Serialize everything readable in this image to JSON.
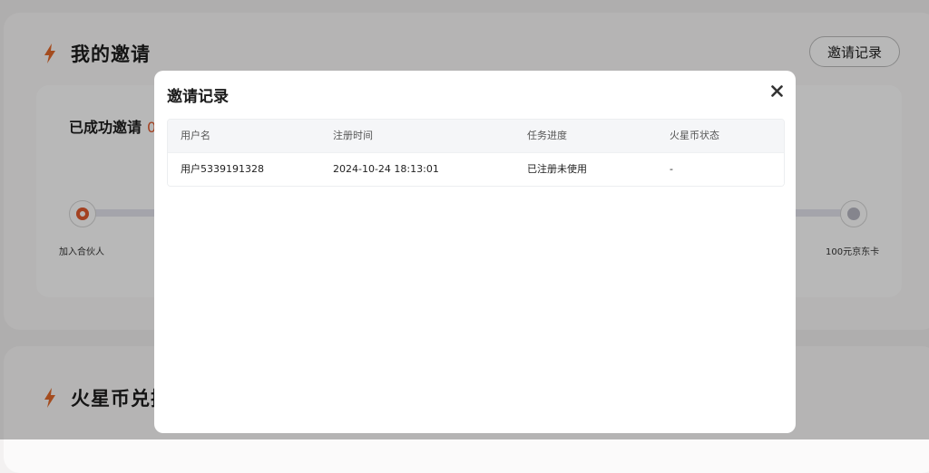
{
  "background": {
    "invite_section": {
      "title": "我的邀请",
      "record_button": "邀请记录",
      "success_label": "已成功邀请",
      "success_count": "0",
      "progress": {
        "start_label": "加入合伙人",
        "end_label": "100元京东卡"
      }
    },
    "exchange_section": {
      "title": "火星币兑换"
    }
  },
  "modal": {
    "title": "邀请记录",
    "close_icon": "close-icon",
    "table": {
      "columns": [
        "用户名",
        "注册时间",
        "任务进度",
        "火星币状态"
      ],
      "rows": [
        [
          "用户5339191328",
          "2024-10-24 18:13:01",
          "已注册未使用",
          "-"
        ]
      ]
    }
  },
  "colors": {
    "accent": "#e25a2e",
    "bolt": "#e46a2b",
    "overlay": "rgba(0,0,0,0.28)"
  }
}
